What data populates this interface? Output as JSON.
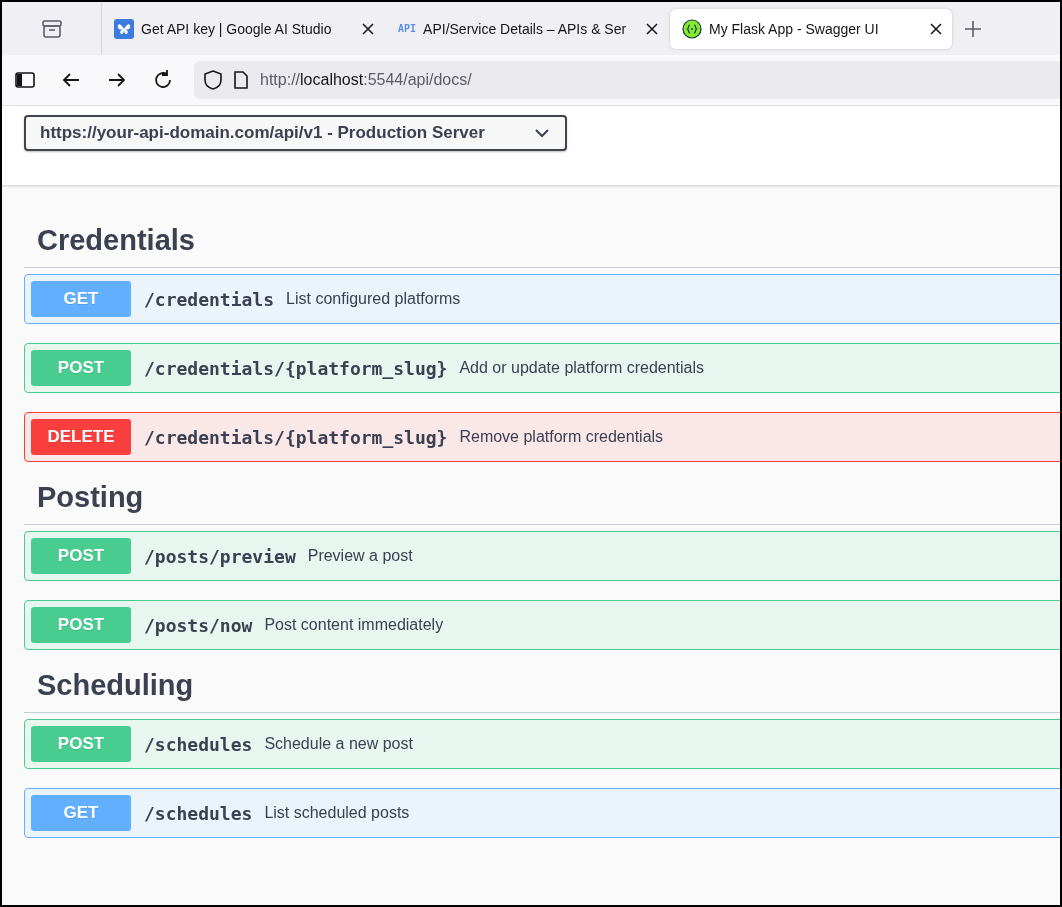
{
  "browser": {
    "tabs": [
      {
        "title": "Get API key | Google AI Studio",
        "kind": "butterfly",
        "selected": false
      },
      {
        "title": "API/Service Details – APIs & Ser",
        "kind": "text",
        "icon_text": "API",
        "selected": false
      },
      {
        "title": "My Flask App - Swagger UI",
        "kind": "braces",
        "selected": true
      }
    ],
    "url": {
      "scheme": "http://",
      "host": "localhost",
      "rest": ":5544/api/docs/"
    }
  },
  "servers": {
    "selected": "https://your-api-domain.com/api/v1 - Production Server"
  },
  "sections": [
    {
      "title": "Credentials",
      "operations": [
        {
          "method": "GET",
          "kind": "get",
          "path": "/credentials",
          "summary": "List configured platforms"
        },
        {
          "method": "POST",
          "kind": "post",
          "path": "/credentials/{platform_slug}",
          "summary": "Add or update platform credentials"
        },
        {
          "method": "DELETE",
          "kind": "delete",
          "path": "/credentials/{platform_slug}",
          "summary": "Remove platform credentials"
        }
      ]
    },
    {
      "title": "Posting",
      "operations": [
        {
          "method": "POST",
          "kind": "post",
          "path": "/posts/preview",
          "summary": "Preview a post"
        },
        {
          "method": "POST",
          "kind": "post",
          "path": "/posts/now",
          "summary": "Post content immediately"
        }
      ]
    },
    {
      "title": "Scheduling",
      "operations": [
        {
          "method": "POST",
          "kind": "post",
          "path": "/schedules",
          "summary": "Schedule a new post"
        },
        {
          "method": "GET",
          "kind": "get",
          "path": "/schedules",
          "summary": "List scheduled posts"
        }
      ]
    }
  ]
}
